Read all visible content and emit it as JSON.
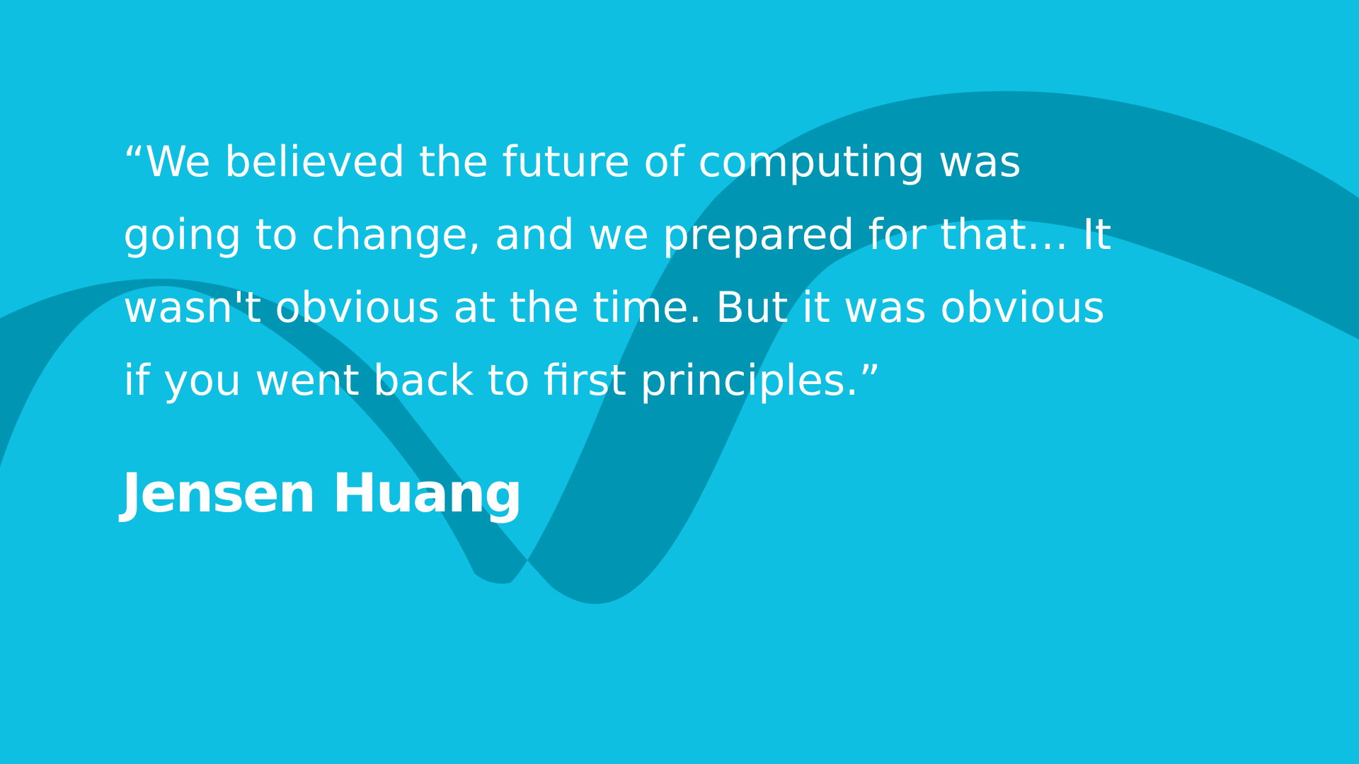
{
  "colors": {
    "background": "#0EBFE1",
    "wave": "#0096B3",
    "text": "#FFFFFF"
  },
  "quote": {
    "lines": [
      "“We believed the future of computing was",
      "going to change, and we prepared for that… It",
      "wasn't obvious at the time. But it was obvious",
      "if you went back to first principles.”"
    ]
  },
  "author": "Jensen Huang"
}
